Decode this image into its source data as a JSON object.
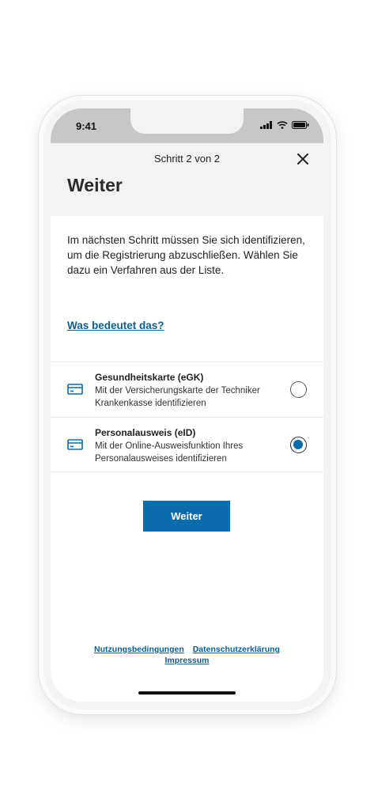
{
  "status": {
    "time": "9:41"
  },
  "header": {
    "step": "Schritt 2 von 2",
    "title": "Weiter"
  },
  "intro": {
    "text": "Im nächsten Schritt müssen Sie sich identifizieren, um die Registrierung abzuschließen. Wählen Sie dazu ein Verfahren aus der Liste."
  },
  "help_link": "Was bedeutet das?",
  "options": [
    {
      "title": "Gesundheitskarte (eGK)",
      "description": "Mit der Versicherungskarte der Techniker Krankenkasse identifizieren",
      "selected": false,
      "icon": "card-icon"
    },
    {
      "title": "Personalausweis (eID)",
      "description": "Mit der Online-Ausweisfunktion Ihres Personalausweises identifizieren",
      "selected": true,
      "icon": "card-icon"
    }
  ],
  "continue_label": "Weiter",
  "footer": {
    "terms": "Nutzungsbedingungen",
    "privacy": "Datenschutzerklärung",
    "imprint": "Impressum"
  },
  "colors": {
    "primary": "#0c6bab",
    "link": "#0c5e92",
    "header_bg": "#f3f3f3"
  }
}
